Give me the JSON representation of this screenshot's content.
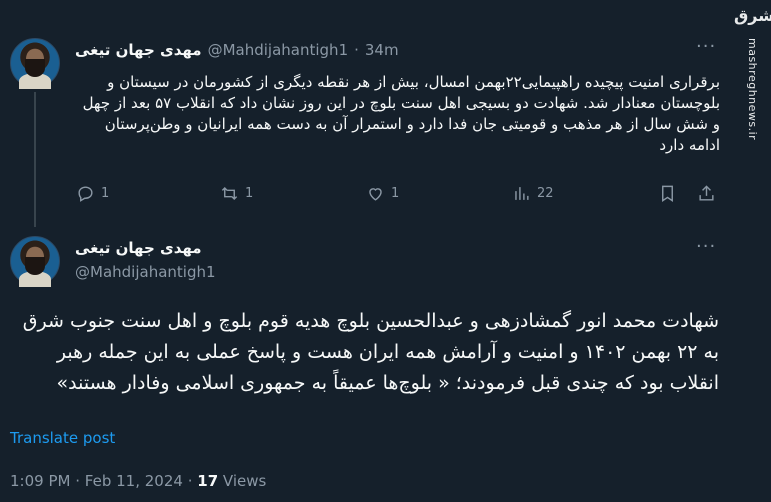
{
  "tweet1": {
    "name": "مهدی جهان تیغی",
    "handle": "@Mahdijahantigh1",
    "separator": "·",
    "time": "34m",
    "text": "برقراری امنیت پیچیده راهپیمایی۲۲بهمن امسال، بیش از هر نقطه دیگری از کشورمان در سیستان و بلوچستان معنادار شد. شهادت دو بسیجی اهل سنت بلوچ در این روز نشان داد که انقلاب ۵۷ بعد از چهل و شش سال از هر مذهب و قومیتی جان فدا دارد و استمرار آن به دست همه ایرانیان و وطن‌پرستان ادامه دارد",
    "actions": {
      "replies": "1",
      "reposts": "1",
      "likes": "1",
      "views": "22"
    }
  },
  "tweet2": {
    "name": "مهدی جهان تیغی",
    "handle": "@Mahdijahantigh1",
    "text": "شهادت محمد انور گمشادزهی و عبدالحسین بلوچ هدیه قوم بلوچ و اهل سنت جنوب شرق به ۲۲ بهمن ۱۴۰۲ و امنیت و آرامش همه ایران هست و پاسخ عملی به این جمله رهبر انقلاب بود که چندی قبل فرمودند؛ « بلوچ‌ها عمیقاً به جمهوری اسلامی وفادار هستند»",
    "translate_label": "Translate post",
    "time": "1:09 PM",
    "date": "Feb 11, 2024",
    "separator": "·",
    "views_count": "17",
    "views_label": "Views"
  },
  "watermark": {
    "logo": "مشرق",
    "site": "mashreghnews.ir"
  },
  "icons": [
    "reply-icon",
    "repost-icon",
    "like-icon",
    "views-icon",
    "bookmark-icon",
    "share-icon",
    "more-icon"
  ],
  "colors": {
    "background": "#15202b",
    "text": "#f7f9f9",
    "muted": "#8b98a5",
    "link": "#1d9bf0"
  }
}
